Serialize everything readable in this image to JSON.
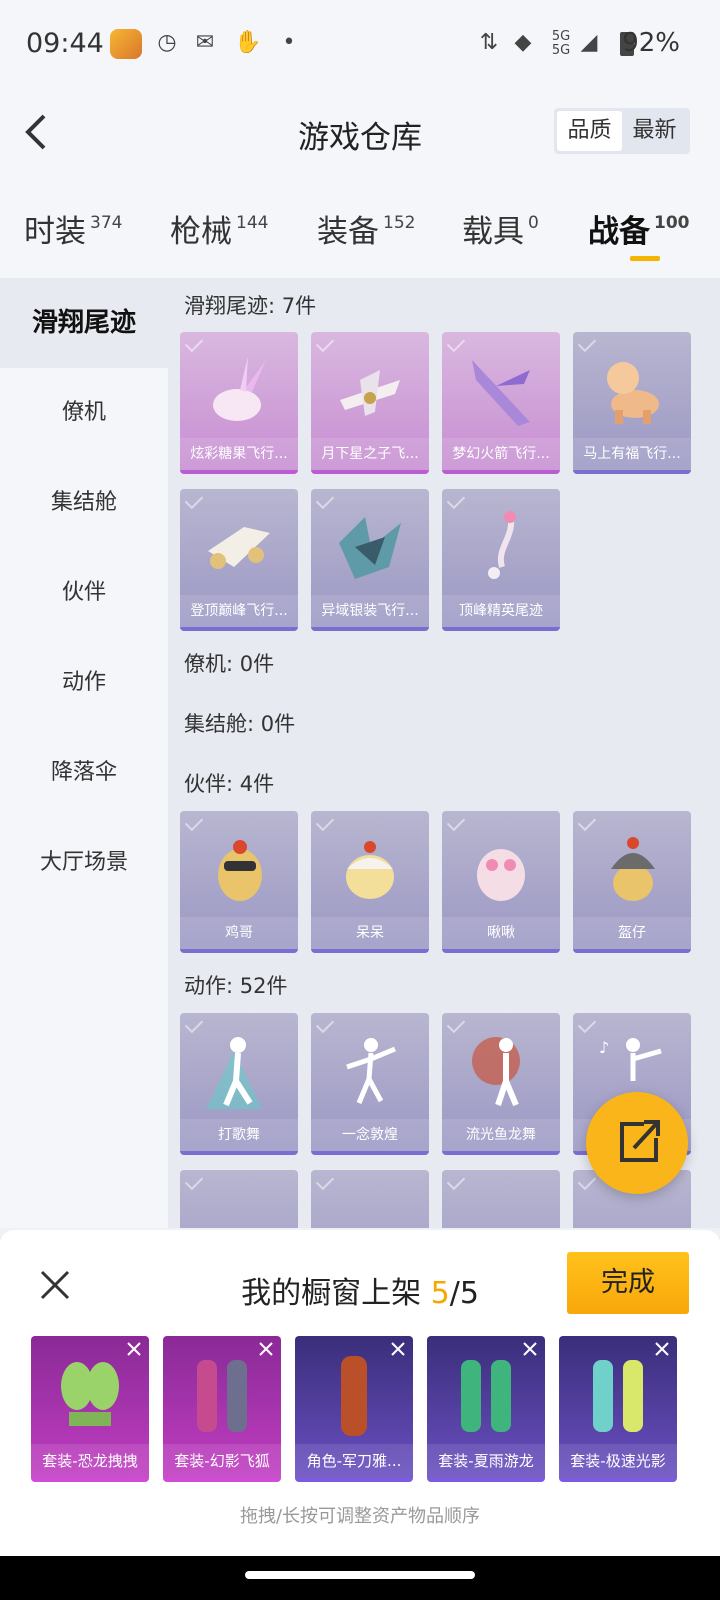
{
  "status": {
    "time": "09:44",
    "battery": "92%",
    "network": "5G"
  },
  "header": {
    "title": "游戏仓库",
    "sort": [
      "品质",
      "最新"
    ],
    "sort_active": 0
  },
  "tabs": [
    {
      "label": "时装",
      "count": "374"
    },
    {
      "label": "枪械",
      "count": "144"
    },
    {
      "label": "装备",
      "count": "152"
    },
    {
      "label": "载具",
      "count": "0"
    },
    {
      "label": "战备",
      "count": "100"
    }
  ],
  "active_tab": 4,
  "sidebar": [
    "滑翔尾迹",
    "僚机",
    "集结舱",
    "伙伴",
    "动作",
    "降落伞",
    "大厅场景"
  ],
  "sections": {
    "glide": {
      "title": "滑翔尾迹: 7件",
      "items": [
        "炫彩糖果飞行...",
        "月下星之子飞...",
        "梦幻火箭飞行...",
        "马上有福飞行...",
        "登顶巅峰飞行...",
        "异域银装飞行...",
        "顶峰精英尾迹"
      ]
    },
    "wingman": {
      "title": "僚机: 0件"
    },
    "pod": {
      "title": "集结舱: 0件"
    },
    "buddy": {
      "title": "伙伴: 4件",
      "items": [
        "鸡哥",
        "呆呆",
        "啾啾",
        "盔仔"
      ]
    },
    "action": {
      "title": "动作: 52件",
      "items": [
        "打歌舞",
        "一念敦煌",
        "流光鱼龙舞",
        ""
      ]
    }
  },
  "panel": {
    "title": "我的橱窗上架 ",
    "count": "5",
    "total": "/5",
    "done": "完成",
    "items": [
      "套装-恐龙拽拽",
      "套装-幻影飞狐",
      "角色-军刀雅...",
      "套装-夏雨游龙",
      "套装-极速光影"
    ],
    "hint": "拖拽/长按可调整资产物品顺序"
  },
  "colors": {
    "accent": "#f5b400",
    "pink_card": "#c78ed2",
    "purple_card": "#9c98c4"
  }
}
